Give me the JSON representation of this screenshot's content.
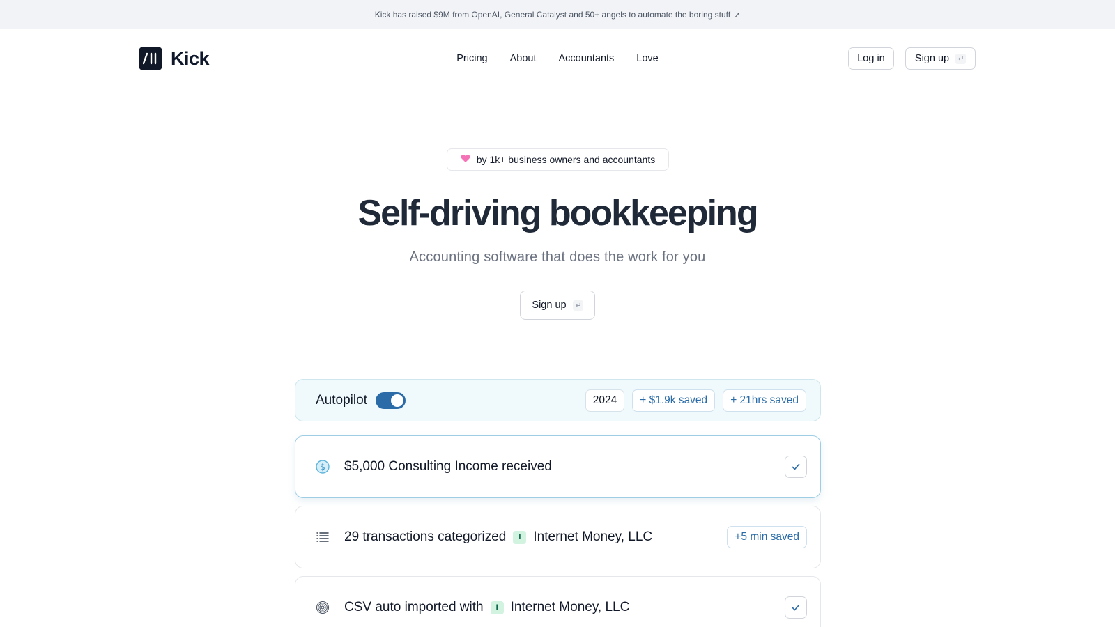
{
  "announcement": {
    "text": "Kick has raised $9M from OpenAI, General Catalyst and 50+ angels to automate the boring stuff",
    "arrow": "↗"
  },
  "brand": {
    "name": "Kick",
    "logo_icon": "kick-logo-icon"
  },
  "nav": {
    "items": [
      {
        "label": "Pricing"
      },
      {
        "label": "About"
      },
      {
        "label": "Accountants"
      },
      {
        "label": "Love"
      }
    ]
  },
  "header_actions": {
    "login_label": "Log in",
    "signup_label": "Sign up",
    "signup_icon": "enter-key-icon"
  },
  "hero": {
    "loved_badge": "by 1k+ business owners and accountants",
    "loved_icon": "heart-icon",
    "title": "Self-driving bookkeeping",
    "subtitle": "Accounting software that does the work for you",
    "signup_label": "Sign up"
  },
  "autopilot": {
    "label": "Autopilot",
    "enabled": true,
    "year": "2024",
    "money_saved": "+ $1.9k saved",
    "hours_saved": "+ 21hrs saved"
  },
  "activity": [
    {
      "icon": "dollar-circle-icon",
      "text": "$5,000 Consulting Income received",
      "status": "check"
    },
    {
      "icon": "list-icon",
      "text_before": "29 transactions categorized",
      "tag": "I",
      "entity": "Internet Money, LLC",
      "saved": "+5 min saved"
    },
    {
      "icon": "fingerprint-icon",
      "text_before": "CSV auto imported with",
      "tag": "I",
      "entity": "Internet Money, LLC",
      "status": "check"
    }
  ],
  "colors": {
    "accent": "#2b6ca8",
    "announcement_bg": "#f1f3f6",
    "autopilot_bg": "#f0f9fc",
    "heart": "#f472b6",
    "tag_bg": "#d1f3e0"
  }
}
